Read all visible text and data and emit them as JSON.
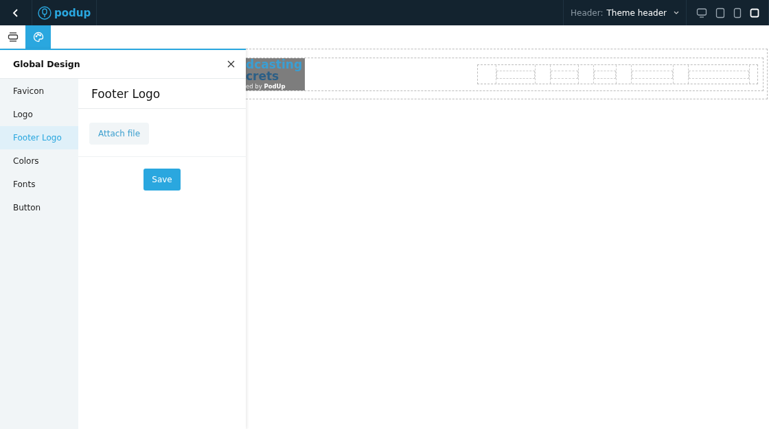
{
  "topbar": {
    "brand": "podup",
    "header_label": "Header:",
    "header_value": "Theme header",
    "devices": [
      {
        "kind": "desktop",
        "selected": false
      },
      {
        "kind": "tablet",
        "selected": false
      },
      {
        "kind": "phone",
        "selected": false
      },
      {
        "kind": "square",
        "selected": true
      }
    ]
  },
  "toolbar": [
    {
      "kind": "layers",
      "selected": false
    },
    {
      "kind": "palette",
      "selected": true
    }
  ],
  "panel": {
    "title": "Global Design",
    "items": [
      {
        "label": "Favicon",
        "selected": false
      },
      {
        "label": "Logo",
        "selected": false
      },
      {
        "label": "Footer Logo",
        "selected": true
      },
      {
        "label": "Colors",
        "selected": false
      },
      {
        "label": "Fonts",
        "selected": false
      },
      {
        "label": "Button",
        "selected": false
      }
    ],
    "section_title": "Footer Logo",
    "attach_button": "Attach file",
    "save_button": "Save"
  },
  "canvas": {
    "logo_lines": [
      "dcasting",
      "crets"
    ],
    "logo_tagline_prefix": "ed by ",
    "logo_tagline_brand": "PodUp"
  }
}
